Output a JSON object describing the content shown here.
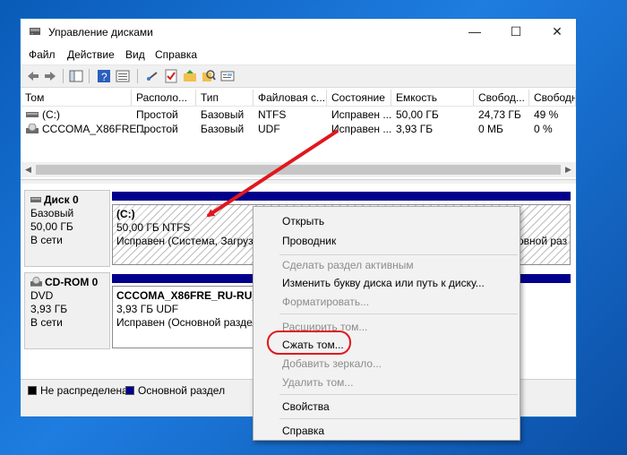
{
  "window": {
    "title": "Управление дисками",
    "controls": {
      "minimize": "—",
      "maximize": "☐",
      "close": "✕"
    }
  },
  "menu": [
    "Файл",
    "Действие",
    "Вид",
    "Справка"
  ],
  "toolbar_icons": [
    "back-icon",
    "forward-icon",
    "panel-icon",
    "help-icon",
    "list-icon",
    "connect-icon",
    "check-icon",
    "folder-icon",
    "search-icon",
    "properties-icon"
  ],
  "volume_table": {
    "columns": [
      "Том",
      "Располо...",
      "Тип",
      "Файловая с...",
      "Состояние",
      "Емкость",
      "Свобод...",
      "Свободно %"
    ],
    "rows": [
      {
        "name": "(C:)",
        "layout": "Простой",
        "type": "Базовый",
        "fs": "NTFS",
        "status": "Исправен ...",
        "capacity": "50,00 ГБ",
        "free": "24,73 ГБ",
        "free_pct": "49 %"
      },
      {
        "name": "CCCOMA_X86FRE...",
        "layout": "Простой",
        "type": "Базовый",
        "fs": "UDF",
        "status": "Исправен ...",
        "capacity": "3,93 ГБ",
        "free": "0 МБ",
        "free_pct": "0 %"
      }
    ]
  },
  "disks": [
    {
      "name": "Диск 0",
      "kind": "Базовый",
      "size": "50,00 ГБ",
      "state": "В сети",
      "partition": {
        "label": "(C:)",
        "size_fs": "50,00 ГБ NTFS",
        "status": "Исправен (Система, Загрузка",
        "status_tail": "овной раз"
      }
    },
    {
      "name": "CD-ROM 0",
      "kind": "DVD",
      "size": "3,93 ГБ",
      "state": "В сети",
      "partition": {
        "label": "CCCOMA_X86FRE_RU-RU_DV",
        "size_fs": "3,93 ГБ UDF",
        "status": "Исправен (Основной раздел)"
      }
    }
  ],
  "legend": [
    {
      "label": "Не распределена",
      "color": "#000000"
    },
    {
      "label": "Основной раздел",
      "color": "#00008b"
    }
  ],
  "context_menu": [
    {
      "label": "Открыть",
      "enabled": true
    },
    {
      "label": "Проводник",
      "enabled": true
    },
    {
      "label": "Сделать раздел активным",
      "enabled": false
    },
    {
      "label": "Изменить букву диска или путь к диску...",
      "enabled": true
    },
    {
      "label": "Форматировать...",
      "enabled": false
    },
    {
      "label": "Расширить том...",
      "enabled": false
    },
    {
      "label": "Сжать том...",
      "enabled": true,
      "highlighted": true
    },
    {
      "label": "Добавить зеркало...",
      "enabled": false
    },
    {
      "label": "Удалить том...",
      "enabled": false
    },
    {
      "label": "Свойства",
      "enabled": true
    },
    {
      "label": "Справка",
      "enabled": true
    }
  ],
  "colors": {
    "accent": "#1a73c9",
    "primary_partition": "#00008b",
    "annotation": "#e1171e"
  }
}
